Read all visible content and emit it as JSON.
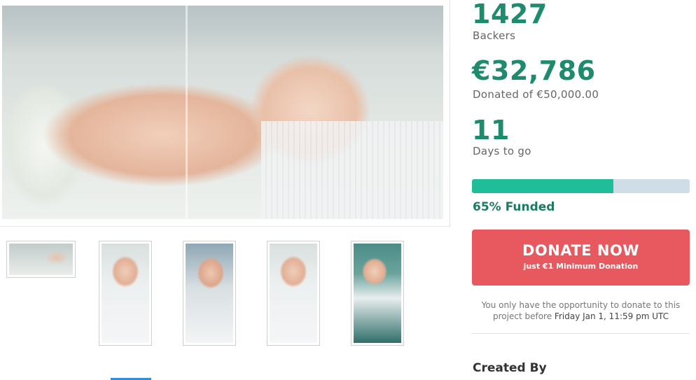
{
  "gallery": {
    "main_image_alt": "main-photo",
    "thumbnails": [
      {
        "name": "thumb-1"
      },
      {
        "name": "thumb-2"
      },
      {
        "name": "thumb-3"
      },
      {
        "name": "thumb-4"
      },
      {
        "name": "thumb-5"
      }
    ]
  },
  "stats": {
    "backers_count": "1427",
    "backers_label": "Backers",
    "donated_amount": "€32,786",
    "donated_label": "Donated of €50,000.00",
    "days_count": "11",
    "days_label": "Days to go",
    "funded_percent": 65,
    "funded_label": "65% Funded"
  },
  "donate": {
    "button_label": "DONATE NOW",
    "button_sublabel": "just €1 Minimum Donation",
    "notice_prefix": "You only have the opportunity to donate to this project before",
    "deadline": "Friday Jan 1, 11:59 pm UTC"
  },
  "created_by_heading": "Created By",
  "colors": {
    "accent_green": "#1e8a6e",
    "progress_fill": "#1fbd98",
    "progress_track": "#cfdde6",
    "donate_red": "#e8585f"
  }
}
